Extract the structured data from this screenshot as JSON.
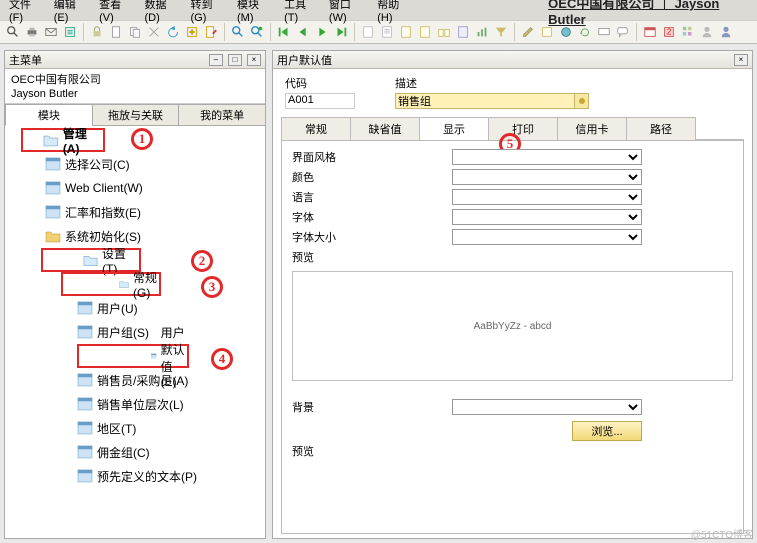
{
  "header": {
    "title": "OEC中国有限公司 ｜ Jayson Butler"
  },
  "menu": {
    "m0": "文件(F)",
    "m1": "编辑(E)",
    "m2": "查看(V)",
    "m3": "数据(D)",
    "m4": "转到(G)",
    "m5": "模块(M)",
    "m6": "工具(T)",
    "m7": "窗口(W)",
    "m8": "帮助(H)"
  },
  "left_panel": {
    "title": "主菜单",
    "company": "OEC中国有限公司",
    "user": "Jayson Butler",
    "tabs": {
      "t0": "模块",
      "t1": "拖放与关联",
      "t2": "我的菜单"
    },
    "tree": {
      "admin": "管理(A)",
      "select_company": "选择公司(C)",
      "web_client": "Web Client(W)",
      "fx_index": "汇率和指数(E)",
      "sys_init": "系统初始化(S)",
      "settings": "设置(T)",
      "general": "常规(G)",
      "users": "用户(U)",
      "user_groups": "用户组(S)",
      "user_defaults": "用户默认值(E)",
      "sales_buyers": "销售员/采购员(A)",
      "sales_unit_levels": "销售单位层次(L)",
      "region": "地区(T)",
      "commission_group": "佣金组(C)",
      "predefined_text": "预先定义的文本(P)"
    },
    "annot": {
      "a1": "1",
      "a2": "2",
      "a3": "3",
      "a4": "4"
    }
  },
  "right_panel": {
    "title": "用户默认值",
    "form": {
      "code_label": "代码",
      "code_value": "A001",
      "desc_label": "描述",
      "desc_value": "销售组"
    },
    "tabs": {
      "t0": "常规",
      "t1": "缺省值",
      "t2": "显示",
      "t3": "打印",
      "t4": "信用卡",
      "t5": "路径"
    },
    "display": {
      "skin": "界面风格",
      "color": "颜色",
      "language": "语言",
      "font": "字体",
      "font_size": "字体大小",
      "preview": "预览",
      "preview_text": "AaBbYyZz - abcd",
      "background": "背景",
      "browse": "浏览...",
      "preview2": "预览"
    },
    "annot": {
      "a5": "5"
    }
  },
  "watermark": "@51CTO博客"
}
